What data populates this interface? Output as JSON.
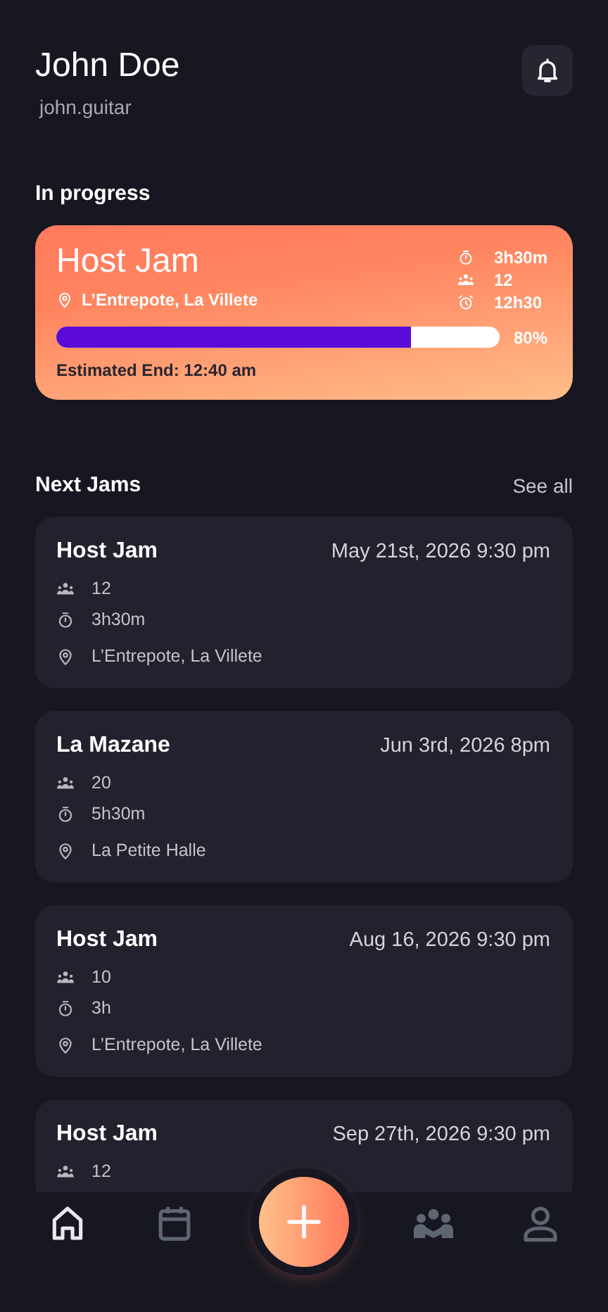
{
  "profile": {
    "name": "John Doe",
    "handle": "john.guitar"
  },
  "in_progress": {
    "heading": "In progress",
    "title": "Host Jam",
    "location": "L’Entrepote, La Villete",
    "stats": [
      {
        "kind": "duration",
        "text": "3h30m"
      },
      {
        "kind": "people",
        "text": "12"
      },
      {
        "kind": "alarm",
        "text": "12h30"
      }
    ],
    "level": 0.8,
    "percent": "80%",
    "estimated_end": "Estimated End: 12:40 am"
  },
  "next_jams": {
    "heading": "Next Jams",
    "see_all": "See all",
    "items": [
      {
        "title": "Host Jam",
        "date": "May 21st, 2026 9:30 pm",
        "rows": [
          {
            "kind": "people",
            "text": "12"
          },
          {
            "kind": "duration",
            "text": "3h30m"
          },
          {
            "kind": "location",
            "text": "L’Entrepote, La Villete"
          }
        ]
      },
      {
        "title": "La Mazane",
        "date": "Jun 3rd, 2026 8pm",
        "rows": [
          {
            "kind": "people",
            "text": "20"
          },
          {
            "kind": "duration",
            "text": "5h30m"
          },
          {
            "kind": "location",
            "text": "La Petite Halle"
          }
        ]
      },
      {
        "title": "Host Jam",
        "date": "Aug 16, 2026 9:30 pm",
        "rows": [
          {
            "kind": "people",
            "text": "10"
          },
          {
            "kind": "duration",
            "text": "3h"
          },
          {
            "kind": "location",
            "text": "L’Entrepote, La Villete"
          }
        ]
      },
      {
        "title": "Host Jam",
        "date": "Sep 27th, 2026 9:30 pm",
        "rows": [
          {
            "kind": "people",
            "text": "12"
          }
        ]
      }
    ]
  },
  "nav": [
    {
      "kind": "home",
      "selected": true
    },
    {
      "kind": "calendar",
      "selected": false
    },
    {
      "kind": "add",
      "selected": false
    },
    {
      "kind": "group",
      "selected": false
    },
    {
      "kind": "person",
      "selected": false
    }
  ]
}
